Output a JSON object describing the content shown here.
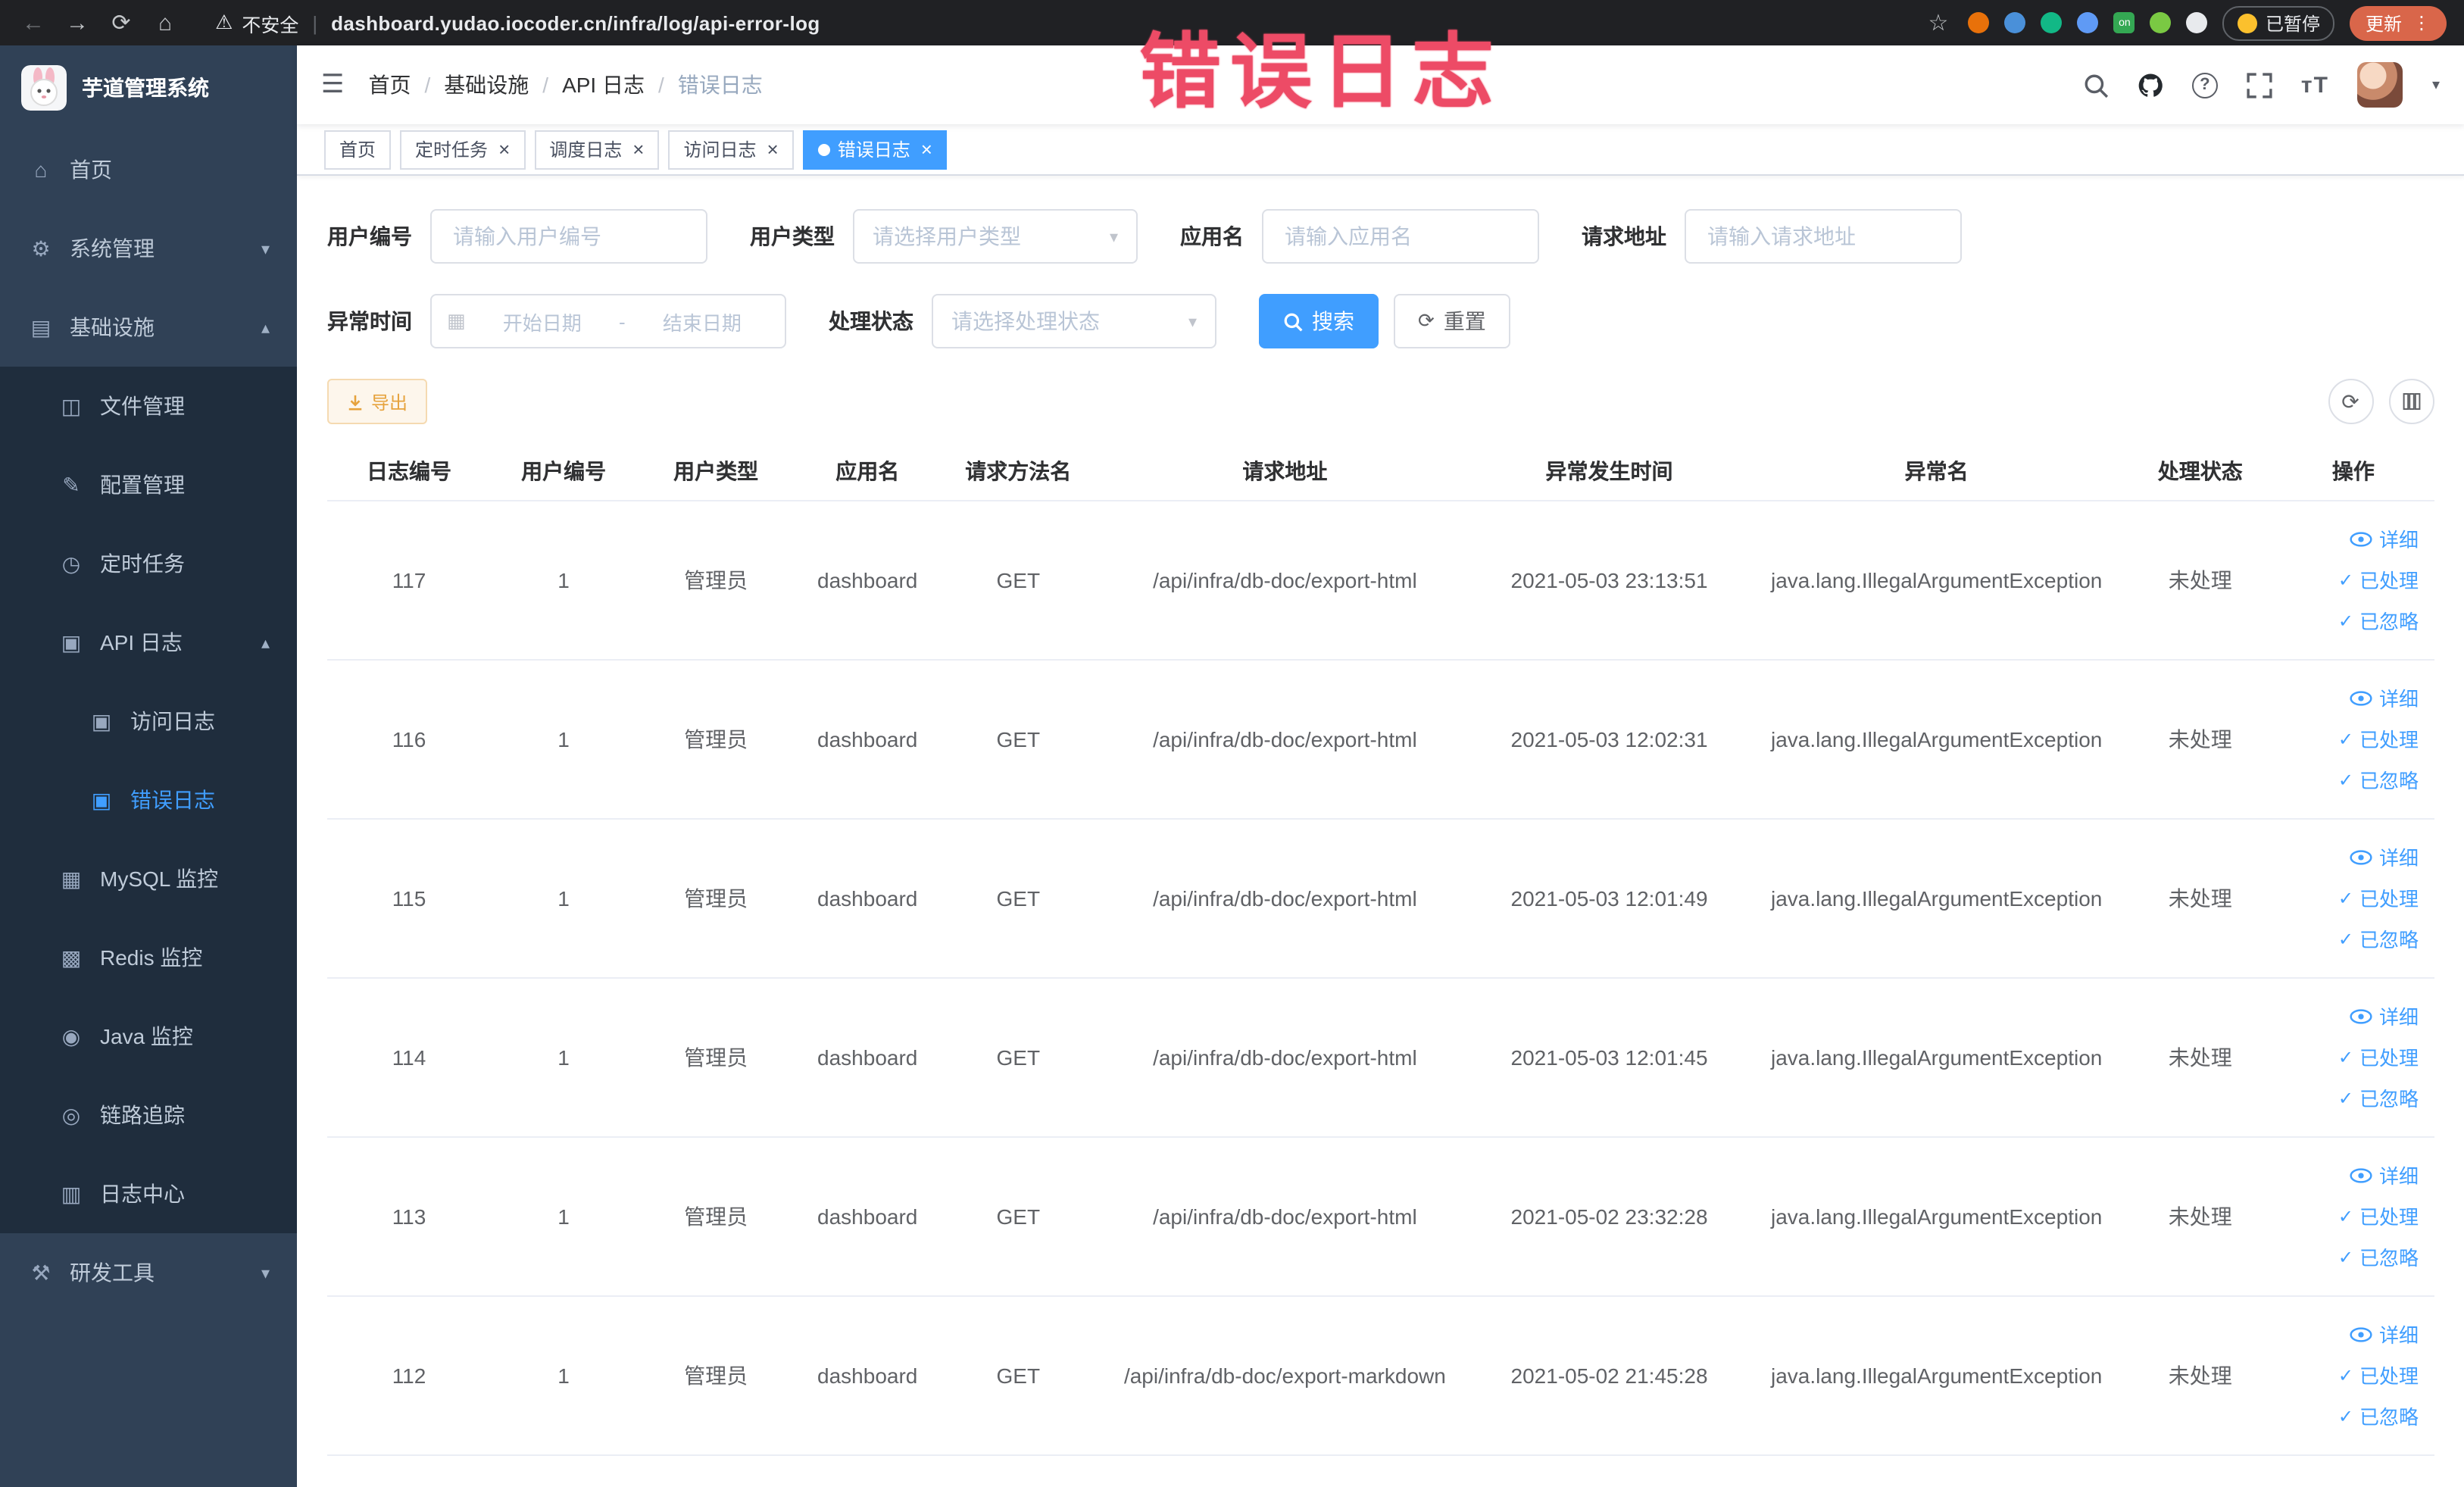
{
  "colors": {
    "accent": "#409EFF",
    "warning": "#E6A23C",
    "annotation_red": "#ED4B66",
    "sidebar_bg": "#304156",
    "submenu_bg": "#1F2D3D"
  },
  "icons": {
    "back": "←",
    "forward": "→",
    "reload": "⟳",
    "home": "⌂",
    "warning": "⚠",
    "star": "☆",
    "kebab": "⋮",
    "hamburger": "☰",
    "chevron_down": "▾",
    "chevron_up": "▴",
    "close": "×",
    "dot": "●",
    "check": "✓",
    "calendar": "▦",
    "refresh": "⟳",
    "question": "?",
    "font_size": "тT",
    "on_badge": "on",
    "menu_home": "⌂",
    "menu_system": "⚙",
    "menu_infra": "▤",
    "menu_file": "◫",
    "menu_config": "✎",
    "menu_job": "◷",
    "menu_apilog": "▣",
    "menu_accesslog": "▣",
    "menu_errorlog": "▣",
    "menu_mysql": "▦",
    "menu_redis": "▩",
    "menu_java": "◉",
    "menu_trace": "◎",
    "menu_logcenter": "▥",
    "menu_tools": "⚒"
  },
  "browser": {
    "security_label": "不安全",
    "url": "dashboard.yudao.iocoder.cn/infra/log/api-error-log",
    "paused_badge": "已暂停",
    "update_button": "更新"
  },
  "annotation": "错误日志",
  "sidebar": {
    "logo_title": "芋道管理系统",
    "menu": [
      {
        "label": "首页"
      },
      {
        "label": "系统管理"
      },
      {
        "label": "基础设施"
      },
      {
        "label": "文件管理"
      },
      {
        "label": "配置管理"
      },
      {
        "label": "定时任务"
      },
      {
        "label": "API 日志"
      },
      {
        "label": "访问日志"
      },
      {
        "label": "错误日志"
      },
      {
        "label": "MySQL 监控"
      },
      {
        "label": "Redis 监控"
      },
      {
        "label": "Java 监控"
      },
      {
        "label": "链路追踪"
      },
      {
        "label": "日志中心"
      },
      {
        "label": "研发工具"
      }
    ]
  },
  "breadcrumb": [
    "首页",
    "基础设施",
    "API 日志",
    "错误日志"
  ],
  "tabs": [
    {
      "label": "首页"
    },
    {
      "label": "定时任务"
    },
    {
      "label": "调度日志"
    },
    {
      "label": "访问日志"
    },
    {
      "label": "错误日志"
    }
  ],
  "filters": {
    "user_id_label": "用户编号",
    "user_id_placeholder": "请输入用户编号",
    "user_type_label": "用户类型",
    "user_type_placeholder": "请选择用户类型",
    "app_name_label": "应用名",
    "app_name_placeholder": "请输入应用名",
    "request_url_label": "请求地址",
    "request_url_placeholder": "请输入请求地址",
    "exception_time_label": "异常时间",
    "date_start_placeholder": "开始日期",
    "date_separator": "-",
    "date_end_placeholder": "结束日期",
    "process_status_label": "处理状态",
    "process_status_placeholder": "请选择处理状态",
    "search_button": "搜索",
    "reset_button": "重置"
  },
  "toolbar": {
    "export_button": "导出"
  },
  "table": {
    "columns": [
      "日志编号",
      "用户编号",
      "用户类型",
      "应用名",
      "请求方法名",
      "请求地址",
      "异常发生时间",
      "异常名",
      "处理状态",
      "操作"
    ],
    "action_labels": [
      "详细",
      "已处理",
      "已忽略"
    ],
    "rows": [
      {
        "id": "117",
        "user_id": "1",
        "user_type": "管理员",
        "app": "dashboard",
        "method": "GET",
        "url": "/api/infra/db-doc/export-html",
        "time": "2021-05-03 23:13:51",
        "exception": "java.lang.IllegalArgumentException",
        "status": "未处理"
      },
      {
        "id": "116",
        "user_id": "1",
        "user_type": "管理员",
        "app": "dashboard",
        "method": "GET",
        "url": "/api/infra/db-doc/export-html",
        "time": "2021-05-03 12:02:31",
        "exception": "java.lang.IllegalArgumentException",
        "status": "未处理"
      },
      {
        "id": "115",
        "user_id": "1",
        "user_type": "管理员",
        "app": "dashboard",
        "method": "GET",
        "url": "/api/infra/db-doc/export-html",
        "time": "2021-05-03 12:01:49",
        "exception": "java.lang.IllegalArgumentException",
        "status": "未处理"
      },
      {
        "id": "114",
        "user_id": "1",
        "user_type": "管理员",
        "app": "dashboard",
        "method": "GET",
        "url": "/api/infra/db-doc/export-html",
        "time": "2021-05-03 12:01:45",
        "exception": "java.lang.IllegalArgumentException",
        "status": "未处理"
      },
      {
        "id": "113",
        "user_id": "1",
        "user_type": "管理员",
        "app": "dashboard",
        "method": "GET",
        "url": "/api/infra/db-doc/export-html",
        "time": "2021-05-02 23:32:28",
        "exception": "java.lang.IllegalArgumentException",
        "status": "未处理"
      },
      {
        "id": "112",
        "user_id": "1",
        "user_type": "管理员",
        "app": "dashboard",
        "method": "GET",
        "url": "/api/infra/db-doc/export-markdown",
        "time": "2021-05-02 21:45:28",
        "exception": "java.lang.IllegalArgumentException",
        "status": "未处理"
      }
    ]
  }
}
